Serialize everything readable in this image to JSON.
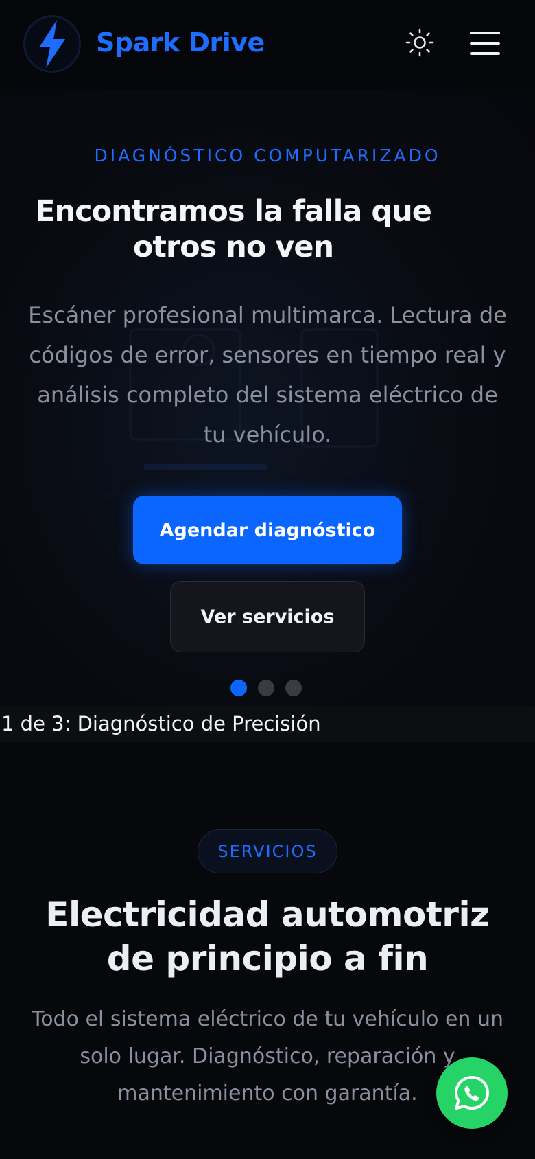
{
  "header": {
    "brand": "Spark Drive",
    "logo_icon": "lightning-bolt-icon",
    "theme_toggle_icon": "sun-icon",
    "menu_icon": "hamburger-menu-icon"
  },
  "hero": {
    "eyebrow": "DIAGNÓSTICO COMPUTARIZADO",
    "title": "Encontramos la falla que otros no ven",
    "description": "Escáner profesional multimarca. Lectura de códigos de error, sensores en tiempo real y análisis completo del sistema eléctrico de tu vehículo.",
    "primary_button": "Agendar diagnóstico",
    "secondary_button": "Ver servicios",
    "slides_total": 3,
    "active_slide": 1,
    "slide_status": "1 de 3: Diagnóstico de Precisión"
  },
  "services": {
    "badge": "SERVICIOS",
    "title": "Electricidad automotriz de principio a fin",
    "description": "Todo el sistema eléctrico de tu vehículo en un solo lugar. Diagnóstico, reparación y mantenimiento con garantía."
  },
  "floating": {
    "whatsapp_icon": "whatsapp-icon"
  },
  "colors": {
    "accent": "#0a66ff",
    "brand_text": "#1f6dff",
    "background": "#07080c",
    "whatsapp": "#25d366"
  }
}
